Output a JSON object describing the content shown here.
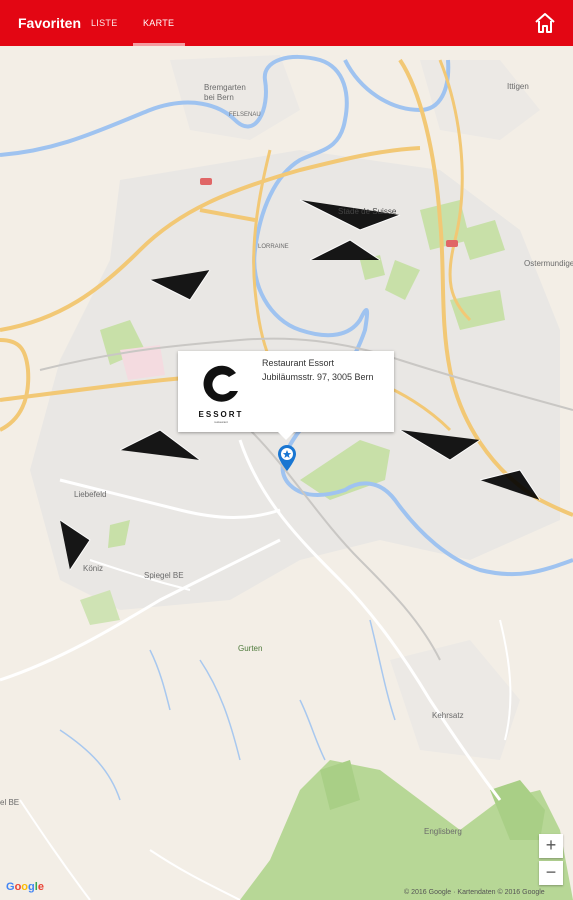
{
  "header": {
    "title": "Favoriten",
    "tabs": [
      {
        "label": "LISTE",
        "active": false
      },
      {
        "label": "KARTE",
        "active": true
      }
    ],
    "home_icon": "home-icon",
    "accent_color": "#e30613"
  },
  "map": {
    "places": {
      "bremgarten": "Bremgarten",
      "bremgarten2": "bei Bern",
      "felsenau": "FELSENAU",
      "ittigen": "Ittigen",
      "stade": "Stade de Suisse",
      "lorraine": "LORRAINE",
      "ostermundigen": "Ostermundigen",
      "liebefeld": "Liebefeld",
      "koeniz": "Köniz",
      "spiegel": "Spiegel BE",
      "gurten": "Gurten",
      "kehrsatz": "Kehrsatz",
      "englisberg": "Englisberg",
      "edge_be": "el BE"
    },
    "popup": {
      "name": "Restaurant Essort",
      "address": "Jubiläumsstr. 97, 3005 Bern",
      "logo_text": "ESSORT",
      "logo_sub": "restaurant"
    },
    "zoom_in": "+",
    "zoom_out": "−",
    "google_logo": "Google",
    "copyright": "© 2016 Google · Kartendaten © 2016 Google"
  }
}
